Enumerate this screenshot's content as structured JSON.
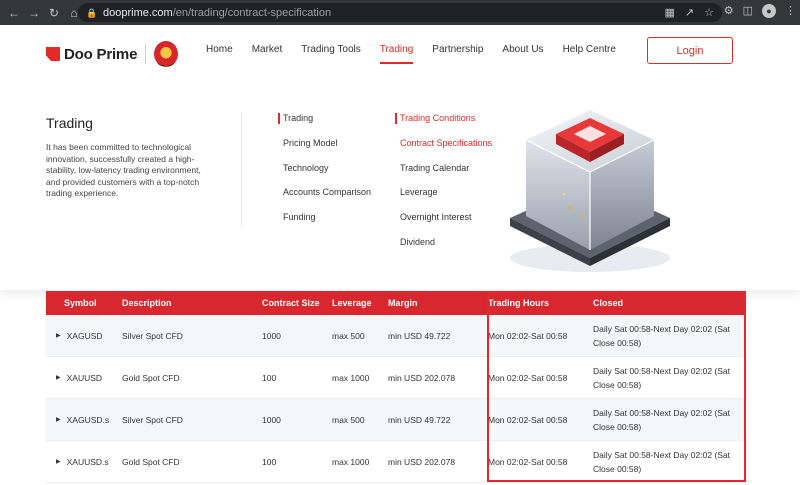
{
  "browser": {
    "url_host": "dooprime.com",
    "url_path": "/en/trading/contract-specification"
  },
  "header": {
    "logo_text": "Doo Prime",
    "nav": [
      {
        "label": "Home"
      },
      {
        "label": "Market"
      },
      {
        "label": "Trading Tools"
      },
      {
        "label": "Trading",
        "active": true
      },
      {
        "label": "Partnership"
      },
      {
        "label": "About Us"
      },
      {
        "label": "Help Centre"
      }
    ],
    "login_label": "Login"
  },
  "mega_menu": {
    "title": "Trading",
    "description": "It has been committed to technological innovation, successfully created a high-stability, low-latency trading environment, and provided customers with a top-notch trading experience.",
    "col1": [
      "Trading",
      "Pricing Model",
      "Technology",
      "Accounts Comparison",
      "Funding"
    ],
    "col2": [
      "Trading Conditions",
      "Contract Specifications",
      "Trading Calendar",
      "Leverage",
      "Overnight Interest",
      "Dividend"
    ]
  },
  "table": {
    "headers": {
      "symbol": "Symbol",
      "description": "Description",
      "contract_size": "Contract Size",
      "leverage": "Leverage",
      "margin": "Margin",
      "trading_hours": "Trading Hours",
      "closed": "Closed"
    },
    "rows": [
      {
        "symbol": "XAGUSD",
        "description": "Silver Spot CFD",
        "contract_size": "1000",
        "leverage": "max 500",
        "margin": "min USD 49.722",
        "trading_hours": "Mon 02:02-Sat 00:58",
        "closed": "Daily Sat 00:58-Next Day 02:02 (Sat Close 00:58)"
      },
      {
        "symbol": "XAUUSD",
        "description": "Gold Spot CFD",
        "contract_size": "100",
        "leverage": "max 1000",
        "margin": "min USD 202.078",
        "trading_hours": "Mon 02:02-Sat 00:58",
        "closed": "Daily Sat 00:58-Next Day 02:02 (Sat Close 00:58)"
      },
      {
        "symbol": "XAGUSD.s",
        "description": "Silver Spot CFD",
        "contract_size": "1000",
        "leverage": "max 500",
        "margin": "min USD 49.722",
        "trading_hours": "Mon 02:02-Sat 00:58",
        "closed": "Daily Sat 00:58-Next Day 02:02 (Sat Close 00:58)"
      },
      {
        "symbol": "XAUUSD.s",
        "description": "Gold Spot CFD",
        "contract_size": "100",
        "leverage": "max 1000",
        "margin": "min USD 202.078",
        "trading_hours": "Mon 02:02-Sat 00:58",
        "closed": "Daily Sat 00:58-Next Day 02:02 (Sat Close 00:58)"
      }
    ]
  },
  "colors": {
    "brand_red": "#e42a26",
    "table_header": "#d8272e",
    "highlight": "#e8262e"
  }
}
